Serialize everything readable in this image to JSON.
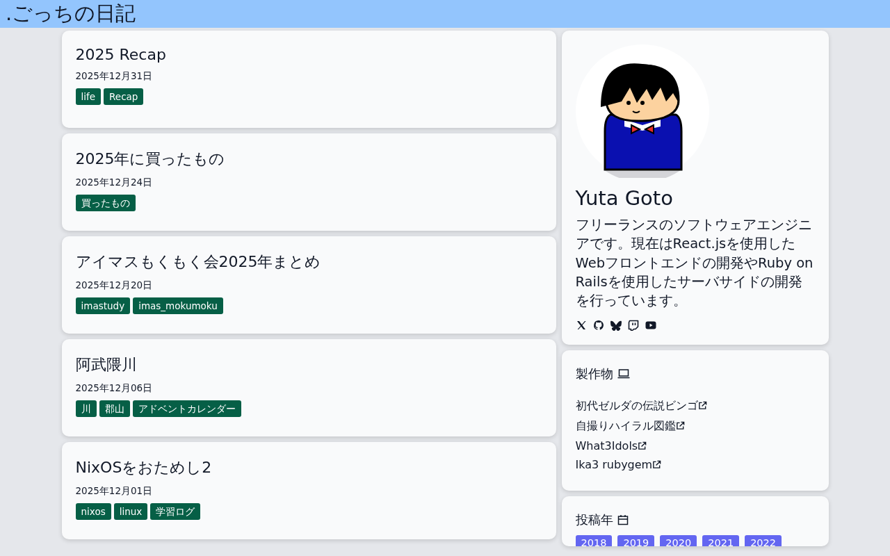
{
  "header": {
    "title": ".ごっちの日記"
  },
  "posts": [
    {
      "title": "2025 Recap",
      "date": "2025年12月31日",
      "tags": [
        "life",
        "Recap"
      ]
    },
    {
      "title": "2025年に買ったもの",
      "date": "2025年12月24日",
      "tags": [
        "買ったもの"
      ]
    },
    {
      "title": "アイマスもくもく会2025年まとめ",
      "date": "2025年12月20日",
      "tags": [
        "imastudy",
        "imas_mokumoku"
      ]
    },
    {
      "title": "阿武隈川",
      "date": "2025年12月06日",
      "tags": [
        "川",
        "郡山",
        "アドベントカレンダー"
      ]
    },
    {
      "title": "NixOSをおためし2",
      "date": "2025年12月01日",
      "tags": [
        "nixos",
        "linux",
        "学習ログ"
      ]
    }
  ],
  "profile": {
    "name": "Yuta Goto",
    "bio": "フリーランスのソフトウェアエンジニアです。現在はReact.jsを使用したWebフロントエンドの開発やRuby on Railsを使用したサーバサイドの開発を行っています。",
    "social_links": [
      {
        "kind": "x"
      },
      {
        "kind": "github"
      },
      {
        "kind": "bluesky"
      },
      {
        "kind": "twitch"
      },
      {
        "kind": "youtube"
      }
    ]
  },
  "works": {
    "title": "製作物",
    "items": [
      "初代ゼルダの伝説ビンゴ",
      "自撮りハイラル図鑑",
      "What3Idols",
      "Ika3 rubygem"
    ]
  },
  "years": {
    "title": "投稿年",
    "items": [
      "2018",
      "2019",
      "2020",
      "2021",
      "2022"
    ]
  }
}
